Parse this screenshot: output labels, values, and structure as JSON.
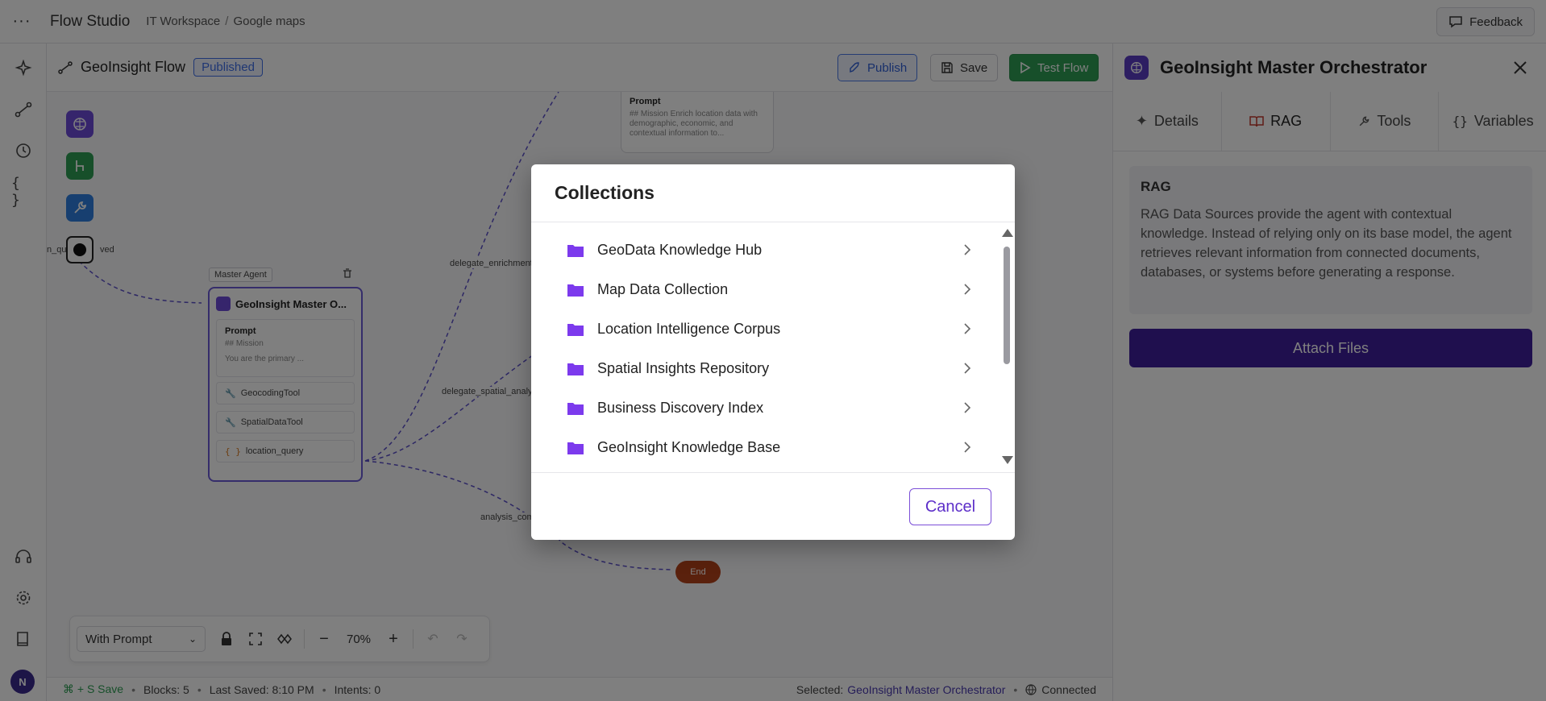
{
  "app": {
    "title": "Flow Studio"
  },
  "breadcrumb": {
    "workspace": "IT Workspace",
    "separator": "/",
    "page": "Google maps"
  },
  "feedback": {
    "label": "Feedback"
  },
  "flow": {
    "name": "GeoInsight Flow",
    "status": "Published"
  },
  "header_buttons": {
    "publish": "Publish",
    "save": "Save",
    "test": "Test Flow"
  },
  "canvas": {
    "master_label": "Master Agent",
    "master_node": {
      "title": "GeoInsight Master O...",
      "prompt_title": "Prompt",
      "prompt_line1": "## Mission",
      "prompt_line2": "You are the primary ...",
      "tools": [
        "GeocodingTool",
        "SpatialDataTool"
      ],
      "variable": "location_query"
    },
    "prompt_node": {
      "title": "Prompt",
      "text": "## Mission Enrich location data with demographic, economic, and contextual information to..."
    },
    "edge_labels": [
      "delegate_enrichment",
      "delegate_spatial_analys",
      "analysis_com",
      "n_qu",
      "ved"
    ],
    "end_node": "End"
  },
  "toolbar": {
    "mode": "With Prompt",
    "zoom": "70%"
  },
  "statusbar": {
    "shortcut": "⌘ + S Save",
    "blocks": "Blocks: 5",
    "last_saved": "Last Saved: 8:10 PM",
    "intents": "Intents: 0",
    "selected_label": "Selected:",
    "selected_name": "GeoInsight Master Orchestrator",
    "connection": "Connected"
  },
  "panel": {
    "title": "GeoInsight Master Orchestrator",
    "tabs": [
      {
        "label": "Details",
        "icon": "sparkle-icon"
      },
      {
        "label": "RAG",
        "icon": "book-icon"
      },
      {
        "label": "Tools",
        "icon": "wrench-icon"
      },
      {
        "label": "Variables",
        "icon": "braces-icon"
      }
    ],
    "rag_title": "RAG",
    "rag_description": "RAG Data Sources provide the agent with contextual knowledge. Instead of relying only on its base model, the agent retrieves relevant information from connected documents, databases, or systems before generating a response.",
    "attach_label": "Attach Files"
  },
  "modal": {
    "title": "Collections",
    "items": [
      "GeoData Knowledge Hub",
      "Map Data Collection",
      "Location Intelligence Corpus",
      "Spatial Insights Repository",
      "Business Discovery Index",
      "GeoInsight Knowledge Base"
    ],
    "cancel_label": "Cancel",
    "scroll_position": 0.0
  },
  "colors": {
    "accent_purple": "#5b3cc4",
    "publish_blue": "#3f6ee8",
    "test_green": "#2e9e55",
    "attach_button": "#3e1f9c",
    "folder_icon": "#7c3aed",
    "end_node": "#b5421a"
  }
}
